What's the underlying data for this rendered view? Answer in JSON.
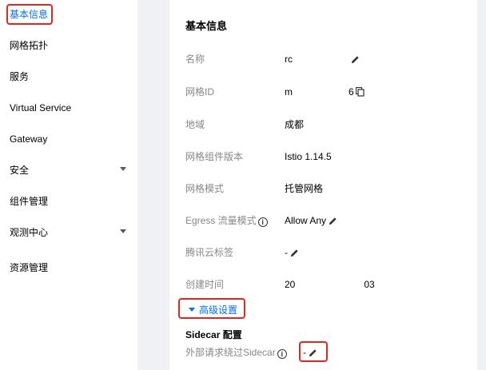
{
  "sidebar": {
    "items": [
      {
        "label": "基本信息",
        "active": true
      },
      {
        "label": "网格拓扑"
      },
      {
        "label": "服务"
      },
      {
        "label": "Virtual Service"
      },
      {
        "label": "Gateway"
      },
      {
        "label": "安全",
        "expandable": true
      },
      {
        "label": "组件管理"
      },
      {
        "label": "观测中心",
        "expandable": true
      },
      {
        "label": "资源管理"
      }
    ]
  },
  "panel": {
    "title": "基本信息",
    "rows": [
      {
        "label": "名称",
        "value_start": "rc",
        "value_end": "",
        "icon": "pencil-icon"
      },
      {
        "label": "网格ID",
        "value_start": "m",
        "value_end": "6",
        "icon": "copy-icon"
      },
      {
        "label": "地域",
        "value": "成都"
      },
      {
        "label": "网格组件版本",
        "value": "Istio 1.14.5"
      },
      {
        "label": "网格模式",
        "value": "托管网格"
      },
      {
        "label": "Egress 流量模式",
        "value": "Allow Any",
        "icon": "pencil-icon",
        "label_icon": "info-icon"
      },
      {
        "label": "腾讯云标签",
        "value": "-",
        "icon": "pencil-icon"
      },
      {
        "label": "创建时间",
        "value_start": "20",
        "value_end": "03"
      }
    ],
    "advanced_link": "高级设置",
    "sidecar_section": {
      "title": "Sidecar 配置",
      "rows": [
        {
          "label": "外部请求绕过Sidecar",
          "value": "-",
          "icon": "pencil-icon",
          "label_icon": "info-icon"
        }
      ]
    }
  },
  "colors": {
    "accent": "#006eff",
    "highlight": "#e3281b",
    "label_gray": "#888888",
    "background_gutter": "#f0f1f4"
  }
}
